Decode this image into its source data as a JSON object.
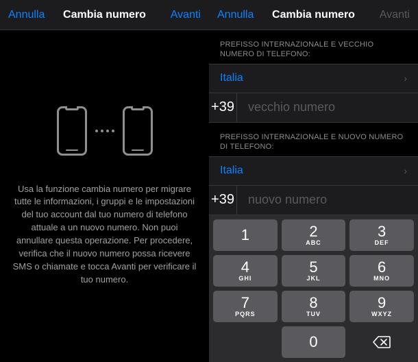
{
  "left": {
    "cancel": "Annulla",
    "title": "Cambia numero",
    "next": "Avanti",
    "intro": "Usa la funzione cambia numero per migrare tutte le informazioni, i gruppi e le impostazioni del tuo account dal tuo numero di telefono attuale a un nuovo numero. Non puoi annullare questa operazione. Per procedere, verifica che il nuovo numero possa ricevere SMS o chiamate e tocca Avanti per verificare il tuo numero."
  },
  "right": {
    "cancel": "Annulla",
    "title": "Cambia numero",
    "next": "Avanti",
    "old_section_label": "PREFISSO INTERNAZIONALE E VECCHIO NUMERO DI TELEFONO:",
    "old_country": "Italia",
    "old_prefix": "+39",
    "old_placeholder": "vecchio numero",
    "new_section_label": "PREFISSO INTERNAZIONALE E NUOVO NUMERO DI TELEFONO:",
    "new_country": "Italia",
    "new_prefix": "+39",
    "new_placeholder": "nuovo numero"
  },
  "keypad": {
    "keys": [
      {
        "num": "1",
        "sub": ""
      },
      {
        "num": "2",
        "sub": "ABC"
      },
      {
        "num": "3",
        "sub": "DEF"
      },
      {
        "num": "4",
        "sub": "GHI"
      },
      {
        "num": "5",
        "sub": "JKL"
      },
      {
        "num": "6",
        "sub": "MNO"
      },
      {
        "num": "7",
        "sub": "PQRS"
      },
      {
        "num": "8",
        "sub": "TUV"
      },
      {
        "num": "9",
        "sub": "WXYZ"
      },
      {
        "num": "0",
        "sub": ""
      }
    ]
  }
}
